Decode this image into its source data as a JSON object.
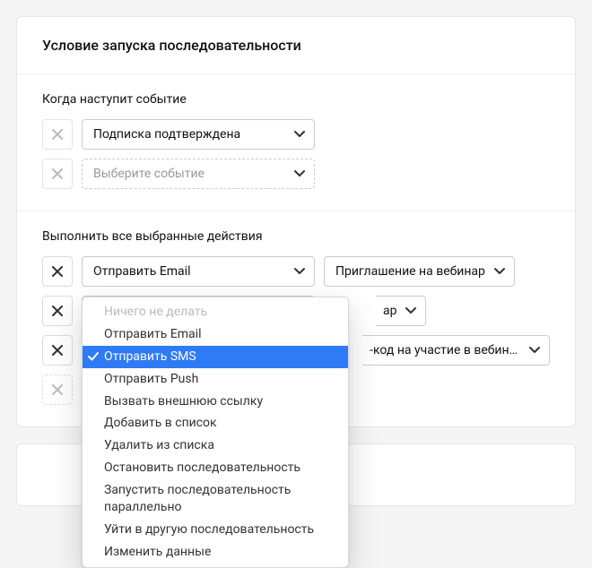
{
  "header": {
    "title": "Условие запуска последовательности"
  },
  "eventSection": {
    "title": "Когда наступит событие",
    "rows": [
      {
        "label": "Подписка подтверждена"
      },
      {
        "placeholder": "Выберите событие"
      }
    ]
  },
  "actionsSection": {
    "title": "Выполнить все выбранные действия",
    "rows": [
      {
        "action": "Отправить Email",
        "target": "Приглашение на вебинар"
      },
      {
        "action": "",
        "target_suffix": "ар"
      },
      {
        "action": "",
        "target_suffix": "-код на участие в вебинаре"
      },
      {
        "ghost": true
      }
    ]
  },
  "dropdown": {
    "items": [
      {
        "label": "Ничего не делать",
        "disabled": true
      },
      {
        "label": "Отправить Email"
      },
      {
        "label": "Отправить SMS",
        "selected": true
      },
      {
        "label": "Отправить Push"
      },
      {
        "label": "Вызвать внешнюю ссылку"
      },
      {
        "label": "Добавить в список"
      },
      {
        "label": "Удалить из списка"
      },
      {
        "label": "Остановить последовательность"
      },
      {
        "label": "Запустить последовательность параллельно"
      },
      {
        "label": "Уйти в другую последовательность"
      },
      {
        "label": "Изменить данные"
      }
    ]
  }
}
